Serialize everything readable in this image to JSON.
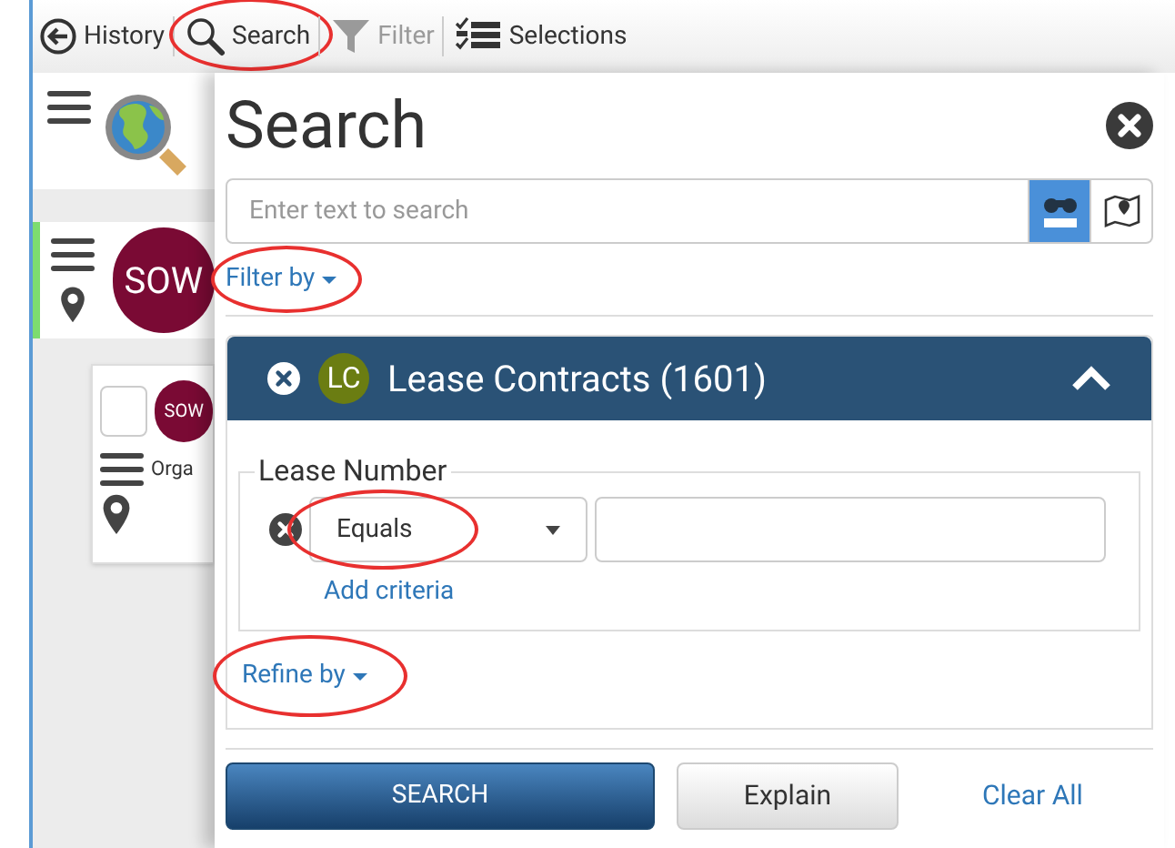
{
  "toolbar": [
    {
      "kind": "history",
      "label": "History",
      "disabled": false,
      "circled": false
    },
    {
      "kind": "search",
      "label": "Search",
      "disabled": false,
      "circled": true
    },
    {
      "kind": "filter",
      "label": "Filter",
      "disabled": true,
      "circled": false
    },
    {
      "kind": "selections",
      "label": "Selections",
      "disabled": false,
      "circled": false
    }
  ],
  "sidebar": {
    "card": {
      "avatar": "SOW",
      "selected": true
    },
    "child": {
      "avatar": "SOW",
      "label": "Orga",
      "checked": false
    }
  },
  "panel": {
    "title": "Search",
    "search": {
      "placeholder": "Enter text to search",
      "modes": [
        {
          "kind": "text",
          "selected": true
        },
        {
          "kind": "map",
          "selected": false
        }
      ]
    },
    "filter_link": {
      "label": "Filter by",
      "circled": true
    },
    "section": {
      "badge": "LC",
      "title": "Lease Contracts (1601)",
      "expanded": true,
      "field": {
        "legend": "Lease Number",
        "operator": "Equals",
        "operator_circled": true,
        "add_link": "Add criteria"
      },
      "refine_link": {
        "label": "Refine by",
        "circled": true
      }
    },
    "buttons": [
      {
        "kind": "primary",
        "label": "SEARCH"
      },
      {
        "kind": "secondary",
        "label": "Explain"
      },
      {
        "kind": "link",
        "label": "Clear All"
      }
    ]
  }
}
